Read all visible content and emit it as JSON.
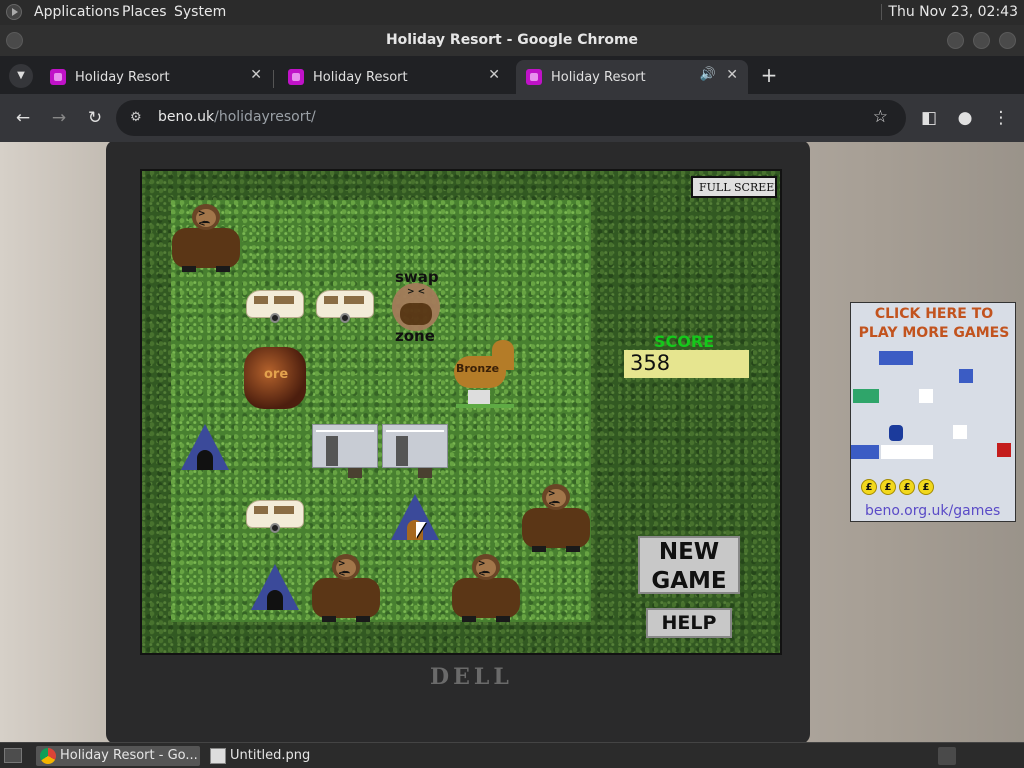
{
  "system_bar": {
    "menus": [
      "Applications",
      "Places",
      "System"
    ],
    "clock": "Thu Nov 23, 02:43"
  },
  "window": {
    "title": "Holiday Resort - Google Chrome"
  },
  "tabs": [
    {
      "label": "Holiday Resort",
      "active": false
    },
    {
      "label": "Holiday Resort",
      "active": false
    },
    {
      "label": "Holiday Resort",
      "active": true,
      "audio": true
    }
  ],
  "toolbar": {
    "url_host": "beno.uk",
    "url_path": "/holidayresort/"
  },
  "game": {
    "full_screen_label": "FULL SCREEN",
    "score_title": "SCORE",
    "score": "358",
    "new_game_line1": "NEW",
    "new_game_line2": "GAME",
    "help_label": "HELP",
    "swap_label": "swap",
    "zone_label": "zone",
    "ore_label": "ore",
    "statue_label": "Bronze",
    "laptop_brand": "DELL"
  },
  "ad": {
    "line1": "CLICK HERE TO",
    "line2": "PLAY MORE GAMES",
    "coin_symbol": "£",
    "link": "beno.org.uk/games"
  },
  "taskbar": {
    "items": [
      {
        "label": "Holiday Resort - Go...",
        "active": true
      },
      {
        "label": "Untitled.png",
        "active": false
      }
    ]
  }
}
